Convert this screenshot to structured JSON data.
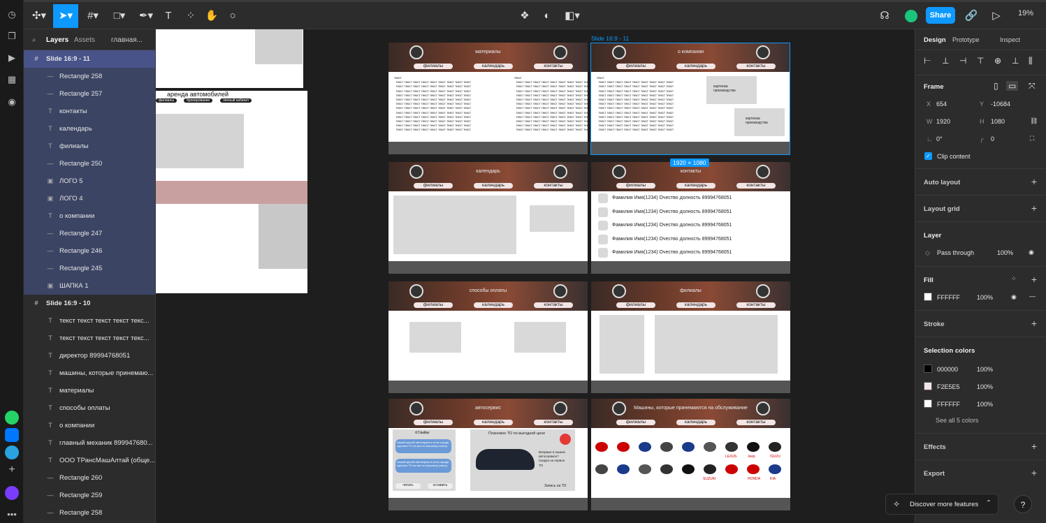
{
  "toolbar": {
    "share": "Share",
    "zoom": "19%"
  },
  "left_panel": {
    "tabs": [
      "Layers",
      "Assets",
      "главная..."
    ],
    "layers": [
      {
        "icon": "#",
        "name": "Slide 16:9 - 11",
        "frame": true,
        "selected": true
      },
      {
        "icon": "—",
        "name": "Rectangle 258",
        "sel": true
      },
      {
        "icon": "—",
        "name": "Rectangle 257",
        "sel": true
      },
      {
        "icon": "T",
        "name": "контакты",
        "sel": true
      },
      {
        "icon": "T",
        "name": "календарь",
        "sel": true
      },
      {
        "icon": "T",
        "name": "филиалы",
        "sel": true
      },
      {
        "icon": "—",
        "name": "Rectangle 250",
        "sel": true
      },
      {
        "icon": "▣",
        "name": "ЛОГО 5",
        "sel": true
      },
      {
        "icon": "▣",
        "name": "ЛОГО 4",
        "sel": true
      },
      {
        "icon": "T",
        "name": "о компании",
        "sel": true
      },
      {
        "icon": "—",
        "name": "Rectangle 247",
        "sel": true
      },
      {
        "icon": "—",
        "name": "Rectangle 246",
        "sel": true
      },
      {
        "icon": "—",
        "name": "Rectangle 245",
        "sel": true
      },
      {
        "icon": "▣",
        "name": "ШАПКА 1",
        "sel": true
      },
      {
        "icon": "#",
        "name": "Slide 16:9 - 10",
        "frame": true
      },
      {
        "icon": "T",
        "name": "текст текст текст текст текс..."
      },
      {
        "icon": "T",
        "name": "текст текст текст текст текс..."
      },
      {
        "icon": "T",
        "name": "директор 89994768051"
      },
      {
        "icon": "T",
        "name": "машины, которые принемаю..."
      },
      {
        "icon": "T",
        "name": "материалы"
      },
      {
        "icon": "T",
        "name": "способы оплаты"
      },
      {
        "icon": "T",
        "name": "о компании"
      },
      {
        "icon": "T",
        "name": "главный механик 899947680..."
      },
      {
        "icon": "T",
        "name": "ООО ТРансМашАлтай (обще..."
      },
      {
        "icon": "—",
        "name": "Rectangle 260"
      },
      {
        "icon": "—",
        "name": "Rectangle 259"
      },
      {
        "icon": "—",
        "name": "Rectangle 258"
      },
      {
        "icon": "—",
        "name": "Rectangle 257"
      }
    ]
  },
  "canvas": {
    "frame_label": "Slide 16:9 - 11",
    "size_badge": "1920 × 1080",
    "left_preview_title": "аренда автомобилей",
    "left_preview_nav": [
      "филиалы",
      "бронирование",
      "личный кабинет"
    ],
    "nav": [
      "филиалы",
      "календарь",
      "контакты"
    ],
    "slides": [
      {
        "title": "материалы"
      },
      {
        "title": "о компании",
        "img1": "картинка производства",
        "img2": "картинка производства"
      },
      {
        "title": "календарь"
      },
      {
        "title": "контакты"
      },
      {
        "title": "способы оплаты"
      },
      {
        "title": "филиалы"
      },
      {
        "title": "автосервис"
      },
      {
        "title": "Машины, которые принемаются на обслуживание"
      }
    ],
    "text_block": "текст\n  текст текст текст текст текст текст текст текст текст\n  текст текст текст текст текст текст текст текст текст\n  текст текст текст текст текст текст текст текст текст\n  текст текст текст текст текст текст текст текст текст\n  текст текст текст текст текст текст текст текст текст\n  текст текст текст текст текст текст текст текст текст\n  текст текст текст текст текст текст текст текст текст\n  текст текст текст текст текст текст текст текст текст\n  текст текст текст текст текст текст текст текст текст\n  текст текст текст текст текст текст текст текст текст\n  текст текст текст текст текст текст текст текст текст\n  текст текст текст текст текст текст текст текст текст",
    "contacts": [
      "Фамилия Имя(1234) Очество долность 89994768051",
      "Фамилия Имя(1234) Очество долность 89994768051",
      "Фамилия Имя(1234) Очество долность 89994768051",
      "Фамилия Имя(1234) Очество долность 89994768051",
      "Фамилия Имя(1234) Очество долность 89994768051"
    ],
    "service": {
      "reviews": "отзывы",
      "review_text": "самый крутой автосервис в этом городе, сделали ТО на все по высшему классу",
      "promo": "Плановое ТО по выгодной цене",
      "promo_side": "Впервые в нашем автосервисе? Скидка на первое ТО",
      "btn_read": "читать",
      "btn_leave": "оставить",
      "btn_book": "Запись на ТО"
    },
    "brands": [
      "ISUZU",
      "Jeep",
      "LEXUS",
      "SUZUKI",
      "HONDA",
      "KIA"
    ]
  },
  "right_panel": {
    "tabs": [
      "Design",
      "Prototype",
      "Inspect"
    ],
    "frame_label": "Frame",
    "x": "654",
    "y": "-10684",
    "w": "1920",
    "h": "1080",
    "rotation": "0°",
    "radius": "0",
    "clip": "Clip content",
    "auto_layout": "Auto layout",
    "layout_grid": "Layout grid",
    "layer_title": "Layer",
    "blend": "Pass through",
    "opacity": "100%",
    "fill_title": "Fill",
    "fill_hex": "FFFFFF",
    "fill_opacity": "100%",
    "stroke": "Stroke",
    "selection_colors": "Selection colors",
    "colors": [
      {
        "hex": "000000",
        "pct": "100%",
        "swatch": "#000000"
      },
      {
        "hex": "F2E5E5",
        "pct": "100%",
        "swatch": "#F2E5E5"
      },
      {
        "hex": "FFFFFF",
        "pct": "100%",
        "swatch": "#FFFFFF"
      }
    ],
    "see_all": "See all 5 colors",
    "effects": "Effects",
    "export": "Export"
  },
  "discover": "Discover more features",
  "help": "?"
}
